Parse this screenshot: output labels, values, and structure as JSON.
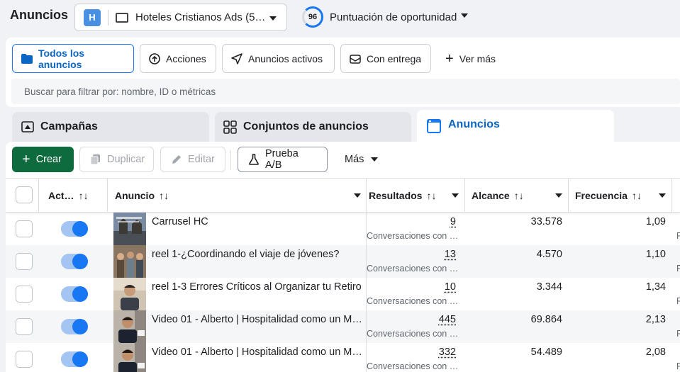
{
  "header": {
    "title": "Anuncios",
    "account": {
      "avatar_letter": "H",
      "name": "Hoteles Cristianos Ads (5…"
    },
    "opportunity": {
      "score": "96",
      "label": "Puntuación de oportunidad"
    }
  },
  "filters": {
    "chips": [
      {
        "label": "Todos los anuncios",
        "icon": "folder-icon",
        "active": true
      },
      {
        "label": "Acciones",
        "icon": "upload-icon",
        "active": false
      },
      {
        "label": "Anuncios activos",
        "icon": "send-icon",
        "active": false
      },
      {
        "label": "Con entrega",
        "icon": "envelope-icon",
        "active": false
      }
    ],
    "more_label": "Ver más",
    "search_placeholder": "Buscar para filtrar por: nombre, ID o métricas"
  },
  "tabs": [
    {
      "label": "Campañas",
      "icon": "campaign-icon",
      "active": false
    },
    {
      "label": "Conjuntos de anuncios",
      "icon": "grid-icon",
      "active": false
    },
    {
      "label": "Anuncios",
      "icon": "ad-icon",
      "active": true
    }
  ],
  "toolbar": {
    "create": "Crear",
    "duplicate": "Duplicar",
    "edit": "Editar",
    "ab_test": "Prueba A/B",
    "more": "Más"
  },
  "table": {
    "columns": {
      "status": "Act…",
      "ad": "Anuncio",
      "results": "Resultados",
      "reach": "Alcance",
      "frequency": "Frecuencia"
    },
    "sort_glyph": "↑↓",
    "rows": [
      {
        "name": "Carrusel HC",
        "results": "9",
        "results_sub": "Conversaciones con …",
        "reach": "33.578",
        "frequency": "1,09",
        "thumb": "thumb-church",
        "right_cut": "P"
      },
      {
        "name": "reel 1-¿Coordinando el viaje de jóvenes?",
        "results": "13",
        "results_sub": "Conversaciones con …",
        "reach": "4.570",
        "frequency": "1,10",
        "thumb": "thumb-group",
        "right_cut": "P"
      },
      {
        "name": "reel 1-3 Errores Críticos al Organizar tu Retiro",
        "results": "10",
        "results_sub": "Conversaciones con …",
        "reach": "3.344",
        "frequency": "1,34",
        "thumb": "thumb-person",
        "right_cut": "P"
      },
      {
        "name": "Video 01 - Alberto | Hospitalidad como un M…",
        "results": "445",
        "results_sub": "Conversaciones con …",
        "reach": "69.864",
        "frequency": "2,13",
        "thumb": "thumb-alberto",
        "right_cut": "P"
      },
      {
        "name": "Video 01 - Alberto | Hospitalidad como un M…",
        "results": "332",
        "results_sub": "Conversaciones con …",
        "reach": "54.489",
        "frequency": "2,08",
        "thumb": "thumb-alberto",
        "right_cut": "P"
      }
    ]
  },
  "colors": {
    "accent": "#1877f2",
    "create_button": "#0e6b3d",
    "toggle_on": "#1877f2"
  }
}
